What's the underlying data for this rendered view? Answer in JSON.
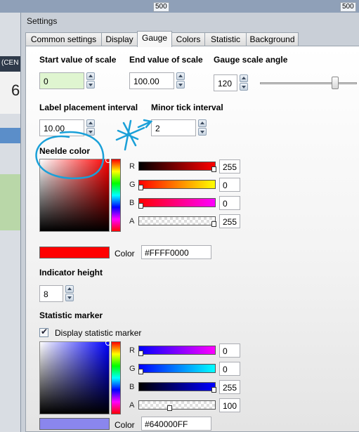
{
  "background": {
    "axis_ticks": [
      "500",
      "500"
    ],
    "left_fragments": [
      "(CEN",
      "6"
    ]
  },
  "dialog": {
    "title": "Settings",
    "tabs": [
      {
        "label": "Common settings",
        "active": false
      },
      {
        "label": "Display",
        "active": false
      },
      {
        "label": "Gauge",
        "active": true
      },
      {
        "label": "Colors",
        "active": false
      },
      {
        "label": "Statistic",
        "active": false
      },
      {
        "label": "Background",
        "active": false
      }
    ]
  },
  "gauge": {
    "start_value": {
      "label": "Start value of scale",
      "value": "0"
    },
    "end_value": {
      "label": "End value of scale",
      "value": "100.00"
    },
    "scale_angle": {
      "label": "Gauge scale angle",
      "value": "120",
      "slider_fraction": 0.8
    },
    "label_interval": {
      "label": "Label placement interval",
      "value": "10.00"
    },
    "minor_tick": {
      "label": "Minor tick interval",
      "value": "2"
    },
    "needle_color": {
      "label": "Neelde color",
      "channels": [
        {
          "name": "R",
          "value": "255",
          "gradient": [
            "#000000",
            "#ff0000"
          ]
        },
        {
          "name": "G",
          "value": "0",
          "gradient": [
            "#ff0000",
            "#ffff00"
          ]
        },
        {
          "name": "B",
          "value": "0",
          "gradient": [
            "#ff0000",
            "#ff00ff"
          ]
        },
        {
          "name": "A",
          "value": "255",
          "gradient": [
            "#ff000000",
            "#ff0000"
          ]
        }
      ],
      "color_label": "Color",
      "hex": "#FFFF0000",
      "swatch": "#ff0000"
    },
    "indicator_height": {
      "label": "Indicator height",
      "value": "8"
    },
    "statistic_marker": {
      "label": "Statistic marker",
      "checkbox_label": "Display statistic marker",
      "checked": true,
      "channels": [
        {
          "name": "R",
          "value": "0",
          "gradient": [
            "#0000ff",
            "#ff00ff"
          ]
        },
        {
          "name": "G",
          "value": "0",
          "gradient": [
            "#0000ff",
            "#00ffff"
          ]
        },
        {
          "name": "B",
          "value": "255",
          "gradient": [
            "#000000",
            "#0000ff"
          ]
        },
        {
          "name": "A",
          "value": "100",
          "gradient": [
            "#0000ff00",
            "#0000ff"
          ]
        }
      ],
      "color_label": "Color",
      "hex": "#640000FF",
      "swatch": "#8a86ee"
    }
  },
  "annotation_color": "#1aa0d8"
}
